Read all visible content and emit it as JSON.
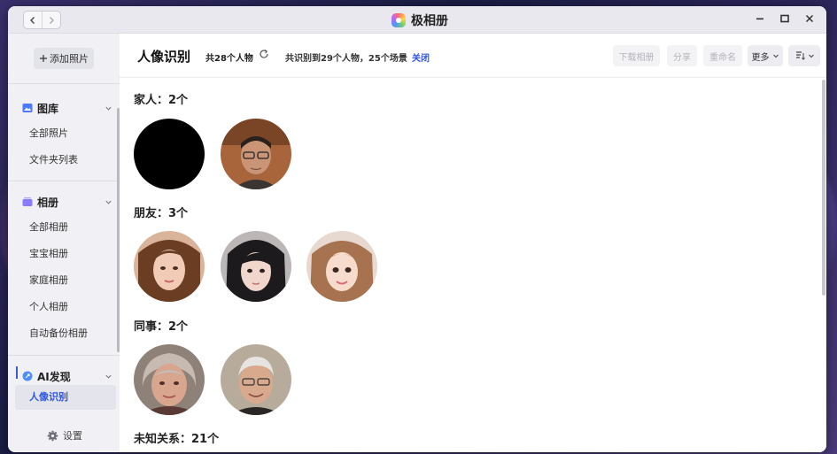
{
  "window": {
    "app_title": "极相册"
  },
  "sidebar": {
    "add_photo_label": "添加照片",
    "sections": [
      {
        "title": "图库",
        "items": [
          "全部照片",
          "文件夹列表"
        ]
      },
      {
        "title": "相册",
        "items": [
          "全部相册",
          "宝宝相册",
          "家庭相册",
          "个人相册",
          "自动备份相册"
        ]
      },
      {
        "title": "AI发现",
        "items": [
          "人像识别"
        ]
      }
    ],
    "settings_label": "设置"
  },
  "toolbar": {
    "page_title": "人像识别",
    "people_count": "共28个人物",
    "recognized_text": "共识别到29个人物，25个场景",
    "close_label": "关闭",
    "download_album_label": "下载相册",
    "share_label": "分享",
    "rename_label": "重命名",
    "more_label": "更多"
  },
  "groups": [
    {
      "title": "家人：2个"
    },
    {
      "title": "朋友：3个"
    },
    {
      "title": "同事：2个"
    },
    {
      "title": "未知关系：21个"
    }
  ],
  "colors": {
    "accent": "#2f55e3",
    "sidebar_bg": "#f1f1f5",
    "titlebar_bg": "#e8e8ee"
  }
}
